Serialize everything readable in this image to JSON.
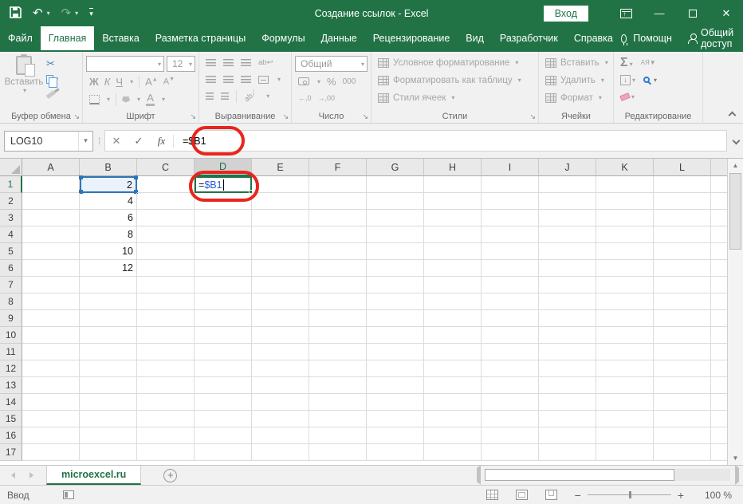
{
  "title_bar": {
    "title": "Создание ссылок  -  Excel",
    "sign_in_label": "Вход"
  },
  "ribbon_tabs": [
    {
      "label": "Файл"
    },
    {
      "label": "Главная",
      "active": true
    },
    {
      "label": "Вставка"
    },
    {
      "label": "Разметка страницы"
    },
    {
      "label": "Формулы"
    },
    {
      "label": "Данные"
    },
    {
      "label": "Рецензирование"
    },
    {
      "label": "Вид"
    },
    {
      "label": "Разработчик"
    },
    {
      "label": "Справка"
    }
  ],
  "ribbon_tabs_right": {
    "assistant": "Помощн",
    "share": "Общий доступ"
  },
  "ribbon": {
    "clipboard": {
      "label": "Буфер обмена",
      "paste": "Вставить"
    },
    "font": {
      "label": "Шрифт",
      "size": "12",
      "bold": "Ж",
      "italic": "К",
      "underline": "Ч",
      "grow": "А",
      "shrink": "А",
      "color": "А"
    },
    "alignment": {
      "label": "Выравнивание",
      "wrap": "ab",
      "orient": "ab"
    },
    "number": {
      "label": "Число",
      "format": "Общий",
      "percent": "%",
      "thousands": "000",
      "inc_decimal": "←,0",
      "dec_decimal": "→,00"
    },
    "styles": {
      "label": "Стили",
      "conditional": "Условное форматирование",
      "as_table": "Форматировать как таблицу",
      "cell_styles": "Стили ячеек"
    },
    "cells": {
      "label": "Ячейки",
      "insert": "Вставить",
      "delete": "Удалить",
      "format": "Формат"
    },
    "editing": {
      "label": "Редактирование",
      "autosum": "Σ",
      "sort": "АЯ▼"
    }
  },
  "formula_bar": {
    "name_box": "LOG10",
    "cancel": "✕",
    "enter": "✓",
    "fx": "fx",
    "formula": "=$B1"
  },
  "grid": {
    "columns": [
      "A",
      "B",
      "C",
      "D",
      "E",
      "F",
      "G",
      "H",
      "I",
      "J",
      "K",
      "L"
    ],
    "rows": [
      1,
      2,
      3,
      4,
      5,
      6,
      7,
      8,
      9,
      10,
      11,
      12,
      13,
      14,
      15,
      16,
      17
    ],
    "active_column": "D",
    "active_row": 1,
    "b_values": [
      "2",
      "4",
      "6",
      "8",
      "10",
      "12"
    ],
    "highlight_cell": {
      "address": "B1",
      "value": "2"
    },
    "editing_cell": {
      "address": "D1",
      "prefix": "=",
      "reference": "$B1"
    }
  },
  "sheet_bar": {
    "tab": "microexcel.ru"
  },
  "status_bar": {
    "mode": "Ввод",
    "zoom": "100 %"
  },
  "colors": {
    "excel_green": "#217346",
    "reference_blue": "#2e75b6",
    "annotation_red": "#e8251c"
  }
}
